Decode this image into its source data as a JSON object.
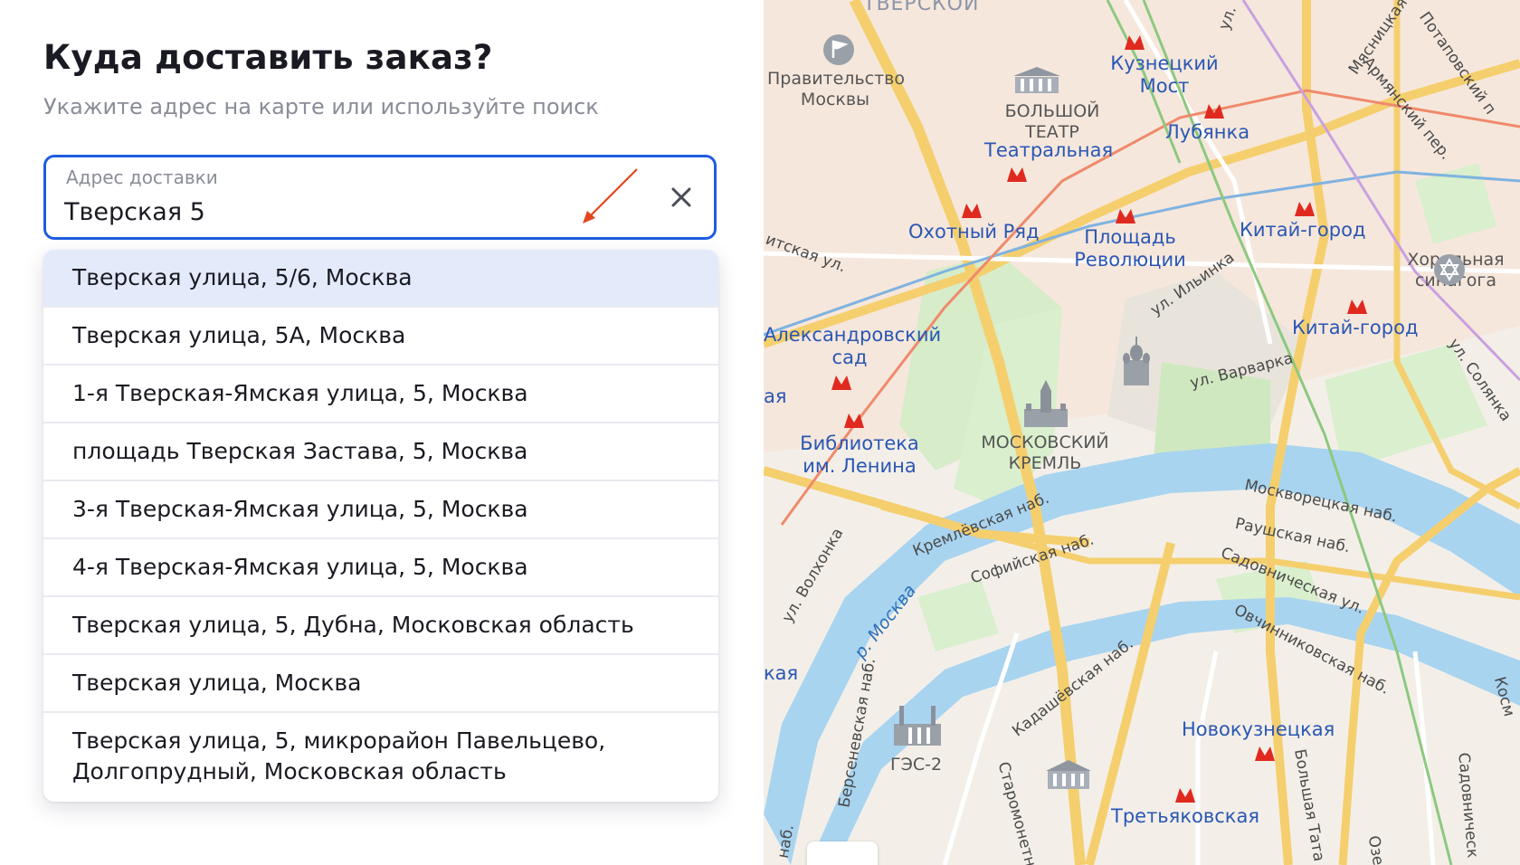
{
  "header": {
    "title": "Куда доставить заказ?",
    "subtitle": "Укажите адрес на карте или используйте поиск"
  },
  "address": {
    "label": "Адрес доставки",
    "value": "Тверская 5",
    "clear_icon": "close-icon"
  },
  "suggestions": [
    "Тверская улица, 5/6, Москва",
    "Тверская улица, 5А, Москва",
    "1-я Тверская-Ямская улица, 5, Москва",
    "площадь Тверская Застава, 5, Москва",
    "3-я Тверская-Ямская улица, 5, Москва",
    "4-я Тверская-Ямская улица, 5, Москва",
    "Тверская улица, 5, Дубна, Московская область",
    "Тверская улица, Москва",
    "Тверская улица, 5, микрорайон Павельцево, Долгопрудный, Московская область"
  ],
  "map": {
    "labels": {
      "tverskoy": "ТВЕРСКОЙ",
      "government": "Правительство Москвы",
      "bolshoi": "БОЛЬШОЙ ТЕАТР",
      "kuznetsky": "Кузнецкий Мост",
      "lubyanka": "Лубянка",
      "teatralnaya": "Театральная",
      "okhotny": "Охотный Ряд",
      "revolution": "Площадь Революции",
      "kitay1": "Китай-город",
      "kitay2": "Китай-город",
      "synagogue": "Хоральная синагога",
      "alexandrovsky": "Александровский сад",
      "library": "Библиотека им. Ленина",
      "kremlin": "МОСКОВСКИЙ КРЕМЛЬ",
      "novokuznetskaya": "Новокузнецкая",
      "tretyakovskaya": "Третьяковская",
      "ges": "ГЭС-2",
      "river": "р. Москва"
    },
    "streets": {
      "myasnitskaya": "Мясницкая",
      "potapovsky": "Потаповский п",
      "armyansky": "Армянский пер.",
      "ilyinka": "ул. Ильинка",
      "varvarka": "ул. Варварка",
      "solyanka": "ул. Солянка",
      "kremlevskaya": "Кремлёвская наб.",
      "sofiyskaya": "Софийская наб.",
      "moskvoretskaya": "Москворецкая наб.",
      "raushskaya": "Раушская наб.",
      "sadovnicheskaya": "Садовническая ул.",
      "ovchinnikovskaya": "Овчинниковская наб.",
      "kadashevskaya": "Кадашёвская наб.",
      "bersenevskaya": "Берсеневская наб.",
      "volkhonka": "ул. Волхонка",
      "vozdvizhenka": "итская ул.",
      "ul_top": "ул.",
      "bolshaya_tat": "Большая Тата",
      "staromonet": "Старомонетн",
      "sadovnich2": "Садовническ",
      "ozer": "Озе",
      "kosm": "Косм",
      "naber": "наб.",
      "aya": "ая",
      "kaya": "кая"
    }
  }
}
